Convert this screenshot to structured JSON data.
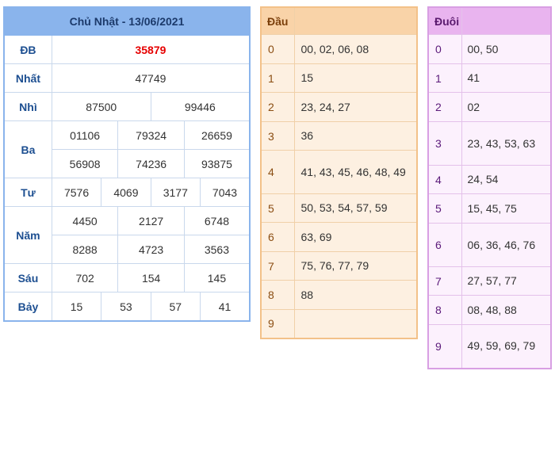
{
  "results": {
    "title": "Chủ Nhật - 13/06/2021",
    "labels": {
      "db": "ĐB",
      "nhat": "Nhất",
      "nhi": "Nhì",
      "ba": "Ba",
      "tu": "Tư",
      "nam": "Năm",
      "sau": "Sáu",
      "bay": "Bảy"
    },
    "db": "35879",
    "nhat": "47749",
    "nhi": [
      "87500",
      "99446"
    ],
    "ba": [
      "01106",
      "79324",
      "26659",
      "56908",
      "74236",
      "93875"
    ],
    "tu": [
      "7576",
      "4069",
      "3177",
      "7043"
    ],
    "nam": [
      "4450",
      "2127",
      "6748",
      "8288",
      "4723",
      "3563"
    ],
    "sau": [
      "702",
      "154",
      "145"
    ],
    "bay": [
      "15",
      "53",
      "57",
      "41"
    ]
  },
  "dau": {
    "header": "Đầu",
    "rows": [
      {
        "key": "0",
        "value": "00, 02, 06, 08"
      },
      {
        "key": "1",
        "value": "15"
      },
      {
        "key": "2",
        "value": "23, 24, 27"
      },
      {
        "key": "3",
        "value": "36"
      },
      {
        "key": "4",
        "value": "41, 43, 45, 46, 48, 49"
      },
      {
        "key": "5",
        "value": "50, 53, 54, 57, 59"
      },
      {
        "key": "6",
        "value": "63, 69"
      },
      {
        "key": "7",
        "value": "75, 76, 77, 79"
      },
      {
        "key": "8",
        "value": "88"
      },
      {
        "key": "9",
        "value": ""
      }
    ]
  },
  "duoi": {
    "header": "Đuôi",
    "rows": [
      {
        "key": "0",
        "value": "00, 50"
      },
      {
        "key": "1",
        "value": "41"
      },
      {
        "key": "2",
        "value": "02"
      },
      {
        "key": "3",
        "value": "23, 43, 53, 63"
      },
      {
        "key": "4",
        "value": "24, 54"
      },
      {
        "key": "5",
        "value": "15, 45, 75"
      },
      {
        "key": "6",
        "value": "06, 36, 46, 76"
      },
      {
        "key": "7",
        "value": "27, 57, 77"
      },
      {
        "key": "8",
        "value": "08, 48, 88"
      },
      {
        "key": "9",
        "value": "49, 59, 69, 79"
      }
    ]
  }
}
